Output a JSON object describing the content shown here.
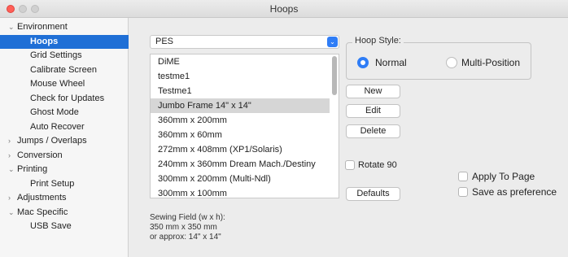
{
  "window": {
    "title": "Hoops"
  },
  "sidebar": {
    "items": [
      {
        "label": "Environment",
        "disclosure": "⌄"
      },
      {
        "label": "Hoops"
      },
      {
        "label": "Grid Settings"
      },
      {
        "label": "Calibrate Screen"
      },
      {
        "label": "Mouse Wheel"
      },
      {
        "label": "Check for Updates"
      },
      {
        "label": "Ghost Mode"
      },
      {
        "label": "Auto Recover"
      },
      {
        "label": "Jumps / Overlaps",
        "disclosure": "›"
      },
      {
        "label": "Conversion",
        "disclosure": "›"
      },
      {
        "label": "Printing",
        "disclosure": "⌄"
      },
      {
        "label": "Print Setup"
      },
      {
        "label": "Adjustments",
        "disclosure": "›"
      },
      {
        "label": "Mac Specific",
        "disclosure": "⌄"
      },
      {
        "label": "USB Save"
      }
    ]
  },
  "main": {
    "format_select": {
      "value": "PES"
    },
    "hoop_list": [
      "DiME",
      "testme1",
      "Testme1",
      "Jumbo Frame 14\" x 14\"",
      "360mm x 200mm",
      "360mm x 60mm",
      "272mm x 408mm (XP1/Solaris)",
      "240mm x 360mm Dream Mach./Destiny",
      "300mm x 200mm (Multi-Ndl)",
      "300mm x 100mm"
    ],
    "sewing_field": {
      "heading": "Sewing Field (w x h):",
      "metric": "350 mm x 350 mm",
      "imperial": "or approx: 14\" x 14\""
    },
    "hoop_style": {
      "label": "Hoop Style:",
      "normal": "Normal",
      "multi": "Multi-Position"
    },
    "buttons": {
      "new": "New",
      "edit": "Edit",
      "delete": "Delete",
      "defaults": "Defaults"
    },
    "rotate_90": "Rotate 90",
    "apply_to_page": "Apply To Page",
    "save_pref": "Save as preference"
  },
  "colors": {
    "accent": "#1f6fd6",
    "radio_accent": "#2f7df6"
  }
}
